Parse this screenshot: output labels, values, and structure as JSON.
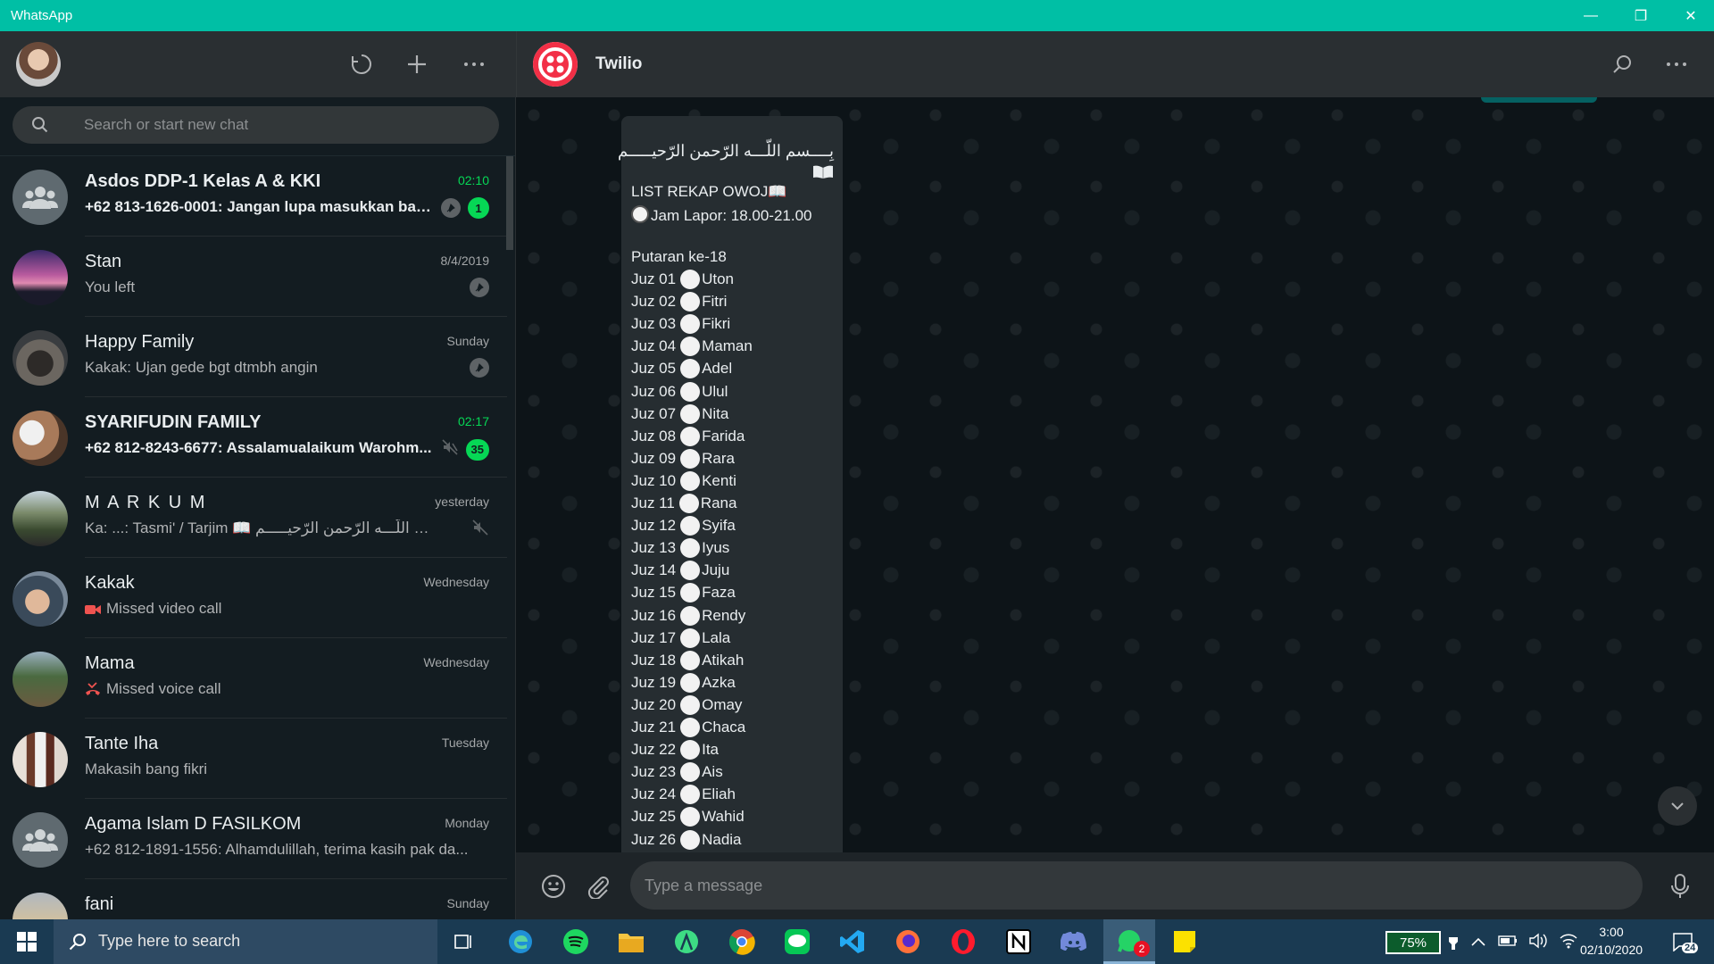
{
  "window": {
    "title": "WhatsApp"
  },
  "sidebar": {
    "search_placeholder": "Search or start new chat",
    "chats": [
      {
        "name": "Asdos DDP-1 Kelas A & KKI",
        "time": "02:10",
        "preview": "+62 813-1626-0001: Jangan lupa masukkan ban...",
        "unread": "1",
        "pinned": true,
        "bold": true
      },
      {
        "name": "Stan",
        "time": "8/4/2019",
        "preview": "You left",
        "pinned": true
      },
      {
        "name": "Happy Family",
        "time": "Sunday",
        "preview": "Kakak: Ujan gede bgt dtmbh angin",
        "pinned": true
      },
      {
        "name": "SYARIFUDIN FAMILY",
        "time": "02:17",
        "preview": "+62 812-8243-6677: Assalamualaikum Warohm...",
        "unread": "35",
        "muted": true,
        "bold": true
      },
      {
        "name": "M A R K U M",
        "time": "yesterday",
        "preview": "Ka: ...: Tasmi' / Tarjim 📖 بِــــسم اللّـــه الرّحمن الرّحيـــــم",
        "muted": true
      },
      {
        "name": "Kakak",
        "time": "Wednesday",
        "preview": "Missed video call"
      },
      {
        "name": "Mama",
        "time": "Wednesday",
        "preview": "Missed voice call"
      },
      {
        "name": "Tante Iha",
        "time": "Tuesday",
        "preview": "Makasih bang fikri"
      },
      {
        "name": "Agama Islam D FASILKOM",
        "time": "Monday",
        "preview": "+62 812-1891-1556: Alhamdulillah, terima kasih pak da..."
      },
      {
        "name": "fani",
        "time": "Sunday",
        "preview": ""
      }
    ]
  },
  "conversation": {
    "contact_name": "Twilio",
    "message": {
      "arabic": "بِــــسم اللّـــه الرّحمن الرّحيـــــم",
      "title": "LIST REKAP OWOJ📖",
      "jam": "Jam Lapor: 18.00-21.00",
      "putaran": "Putaran ke-18",
      "juz": [
        {
          "label": "Juz 01",
          "name": "Uton"
        },
        {
          "label": "Juz 02",
          "name": "Fitri"
        },
        {
          "label": "Juz 03",
          "name": "Fikri"
        },
        {
          "label": "Juz 04",
          "name": "Maman"
        },
        {
          "label": "Juz 05",
          "name": "Adel"
        },
        {
          "label": "Juz 06",
          "name": "Ulul"
        },
        {
          "label": "Juz 07",
          "name": "Nita"
        },
        {
          "label": "Juz 08",
          "name": "Farida"
        },
        {
          "label": "Juz 09",
          "name": "Rara"
        },
        {
          "label": "Juz 10",
          "name": "Kenti"
        },
        {
          "label": "Juz 11",
          "name": "Rana"
        },
        {
          "label": "Juz 12",
          "name": "Syifa"
        },
        {
          "label": "Juz 13",
          "name": "Iyus"
        },
        {
          "label": "Juz 14",
          "name": "Juju"
        },
        {
          "label": "Juz 15",
          "name": "Faza"
        },
        {
          "label": "Juz 16",
          "name": "Rendy"
        },
        {
          "label": "Juz 17",
          "name": "Lala"
        },
        {
          "label": "Juz 18",
          "name": "Atikah"
        },
        {
          "label": "Juz 19",
          "name": "Azka"
        },
        {
          "label": "Juz 20",
          "name": "Omay"
        },
        {
          "label": "Juz 21",
          "name": "Chaca"
        },
        {
          "label": "Juz 22",
          "name": "Ita"
        },
        {
          "label": "Juz 23",
          "name": "Ais"
        },
        {
          "label": "Juz 24",
          "name": "Eliah"
        },
        {
          "label": "Juz 25",
          "name": "Wahid"
        },
        {
          "label": "Juz 26",
          "name": "Nadia"
        }
      ]
    },
    "input_placeholder": "Type a message"
  },
  "taskbar": {
    "search_placeholder": "Type here to search",
    "battery": "75%",
    "time": "3:00",
    "date": "02/10/2020",
    "notifications": "24",
    "whatsapp_badge": "2"
  }
}
